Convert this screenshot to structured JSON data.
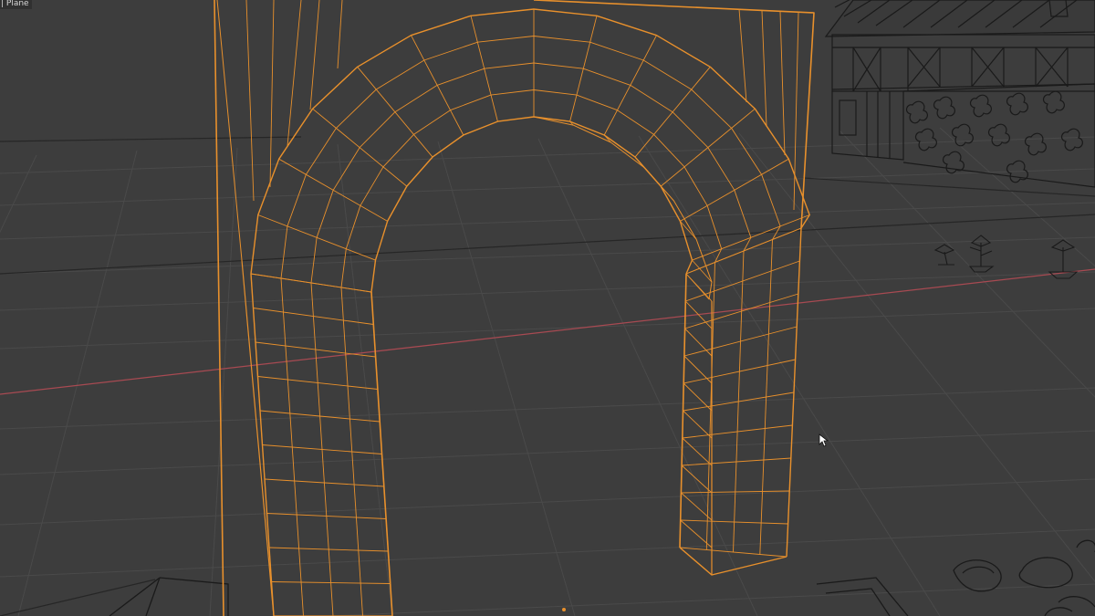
{
  "viewport": {
    "active_object_label": "| Plane",
    "background_color": "#3d3d3d",
    "grid_color": "#4a4a4a",
    "grid_major_color": "#262626",
    "x_axis_color": "#a84a52",
    "selection_wire_color": "#e8902c",
    "scene_wire_color": "#1a1a1a",
    "cursor_icon": "mouse-pointer-icon",
    "origin_icon": "object-origin-dot-icon"
  },
  "scene_objects": [
    {
      "name": "Plane",
      "selected": true,
      "display": "wireframe"
    },
    {
      "name": "timber-frame-house",
      "selected": false,
      "display": "wireframe"
    },
    {
      "name": "flower-plants",
      "selected": false,
      "display": "wireframe"
    },
    {
      "name": "ground-lettering",
      "selected": false,
      "display": "wireframe"
    }
  ]
}
